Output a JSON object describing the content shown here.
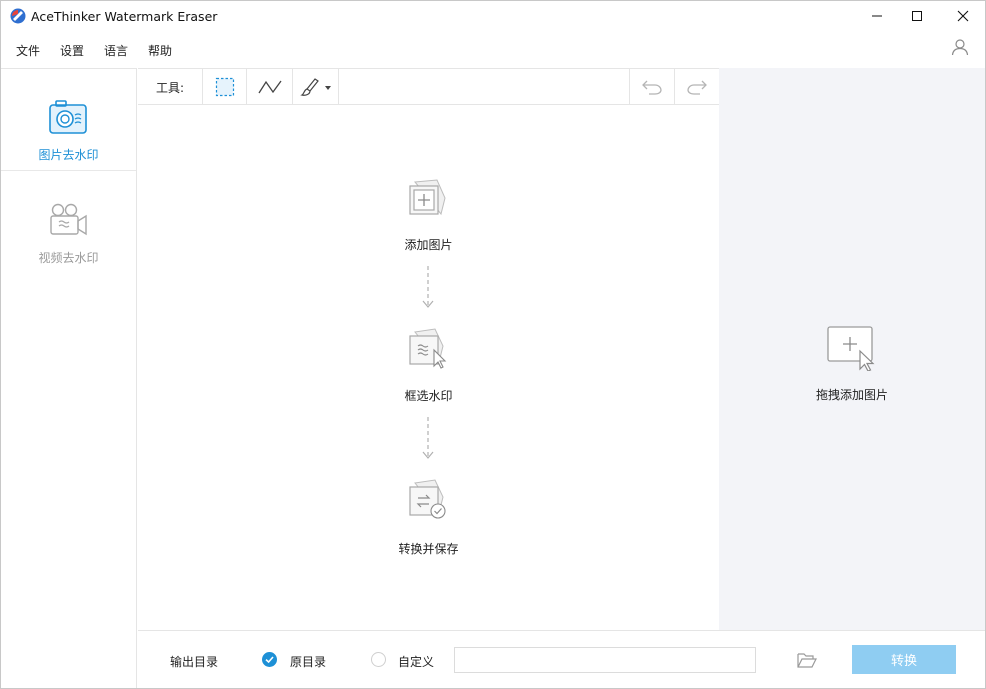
{
  "window": {
    "title": "AceThinker Watermark Eraser"
  },
  "menu": {
    "items": [
      "文件",
      "设置",
      "语言",
      "帮助"
    ]
  },
  "sidebar": {
    "items": [
      {
        "label": "图片去水印",
        "active": true
      },
      {
        "label": "视频去水印",
        "active": false
      }
    ]
  },
  "toolbar": {
    "tools_label": "工具:"
  },
  "workflow": {
    "steps": [
      {
        "label": "添加图片",
        "icon": "add-image-icon"
      },
      {
        "label": "框选水印",
        "icon": "select-watermark-icon"
      },
      {
        "label": "转换并保存",
        "icon": "convert-save-icon"
      }
    ]
  },
  "drop": {
    "label": "拖拽添加图片"
  },
  "footer": {
    "output_label": "输出目录",
    "option_original": "原目录",
    "option_custom": "自定义",
    "path_value": "",
    "convert_label": "转换"
  },
  "colors": {
    "accent": "#1e90d6",
    "convert_button": "#8fcdf2",
    "panel_bg": "#f3f4f8"
  }
}
